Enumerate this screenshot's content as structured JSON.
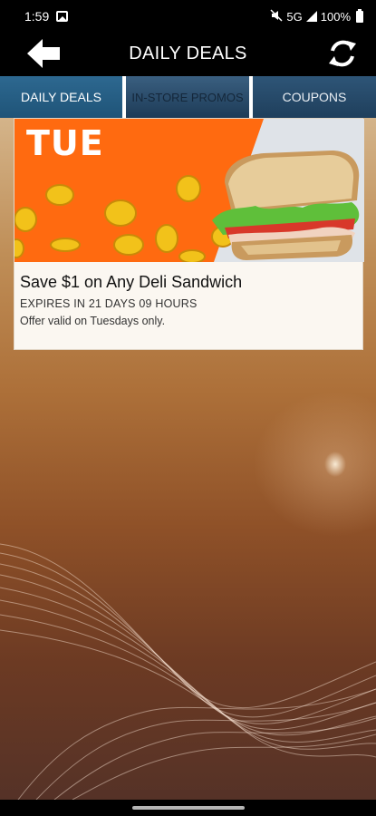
{
  "status_bar": {
    "time": "1:59",
    "network": "5G",
    "battery": "100%"
  },
  "header": {
    "title": "DAILY DEALS"
  },
  "tabs": [
    {
      "label": "DAILY DEALS",
      "active": true
    },
    {
      "label": "IN-STORE PROMOS",
      "active": false
    },
    {
      "label": "COUPONS",
      "active": false
    }
  ],
  "deals": [
    {
      "day_badge": "TUE",
      "title": "Save $1 on Any Deli Sandwich",
      "expiry": "EXPIRES IN 21 DAYS 09 HOURS",
      "note": "Offer valid on Tuesdays only."
    }
  ],
  "colors": {
    "tab_active": "#2d6890",
    "tab_bg": "#1f3f5c",
    "deal_orange": "#ff6a10"
  }
}
